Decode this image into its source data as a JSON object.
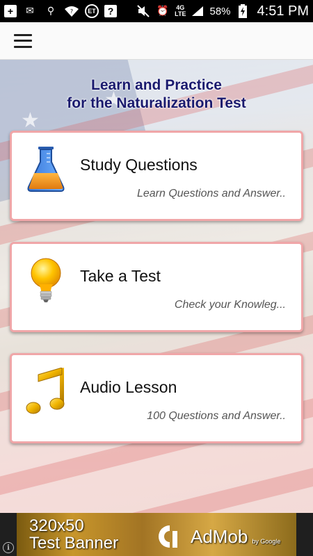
{
  "status_bar": {
    "battery_percent": "58%",
    "time": "4:51 PM",
    "network": "4G LTE",
    "badge_text": "ET",
    "help_badge": "?"
  },
  "app_bar": {
    "menu_icon": "hamburger-menu-icon"
  },
  "main": {
    "headline_line1": "Learn and Practice",
    "headline_line2": "for the Naturalization Test",
    "cards": [
      {
        "title": "Study Questions",
        "subtitle": "Learn Questions and Answer..",
        "icon": "flask-icon"
      },
      {
        "title": "Take a Test",
        "subtitle": "Check your Knowleg...",
        "icon": "lightbulb-icon"
      },
      {
        "title": "Audio Lesson",
        "subtitle": "100 Questions and Answer..",
        "icon": "music-note-icon"
      }
    ]
  },
  "ad": {
    "line1": "320x50",
    "line2": "Test Banner",
    "brand": "AdMob",
    "by": "by Google",
    "info": "i"
  },
  "colors": {
    "headline": "#1a1a6e",
    "card_border": "#f0a6a8",
    "app_bar_bg": "#fafafa"
  }
}
